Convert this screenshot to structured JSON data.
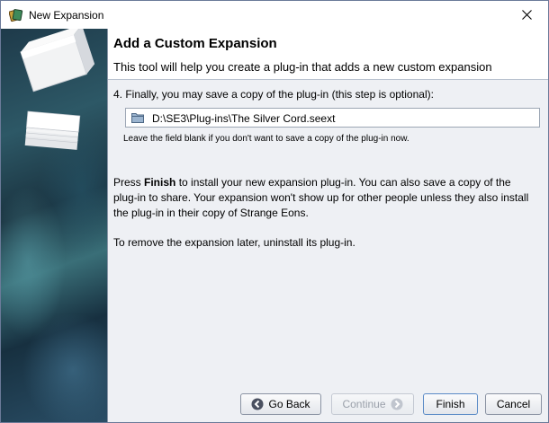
{
  "window": {
    "title": "New Expansion"
  },
  "header": {
    "title": "Add a Custom Expansion",
    "subtitle": "This tool will help you create a plug-in that adds a new custom expansion"
  },
  "step": {
    "label": "4. Finally, you may save a copy of the plug-in (this step is optional):",
    "file_path": "D:\\SE3\\Plug-ins\\The Silver Cord.seext",
    "hint": "Leave the field blank if you don't want to save a copy of the plug-in now."
  },
  "paragraph1": {
    "before": "Press ",
    "bold": "Finish",
    "after": " to install your new expansion plug-in. You can also save a copy of the plug-in to share. Your expansion won't show up for other people unless they also install the plug-in in their copy of Strange Eons."
  },
  "paragraph2": "To remove the expansion later, uninstall its plug-in.",
  "buttons": {
    "back": "Go Back",
    "continue": "Continue",
    "finish": "Finish",
    "cancel": "Cancel"
  },
  "icons": {
    "app": "cards-icon",
    "close": "close-icon",
    "folder": "folder-icon",
    "back_arrow": "arrow-left-icon",
    "continue_arrow": "arrow-right-icon"
  }
}
